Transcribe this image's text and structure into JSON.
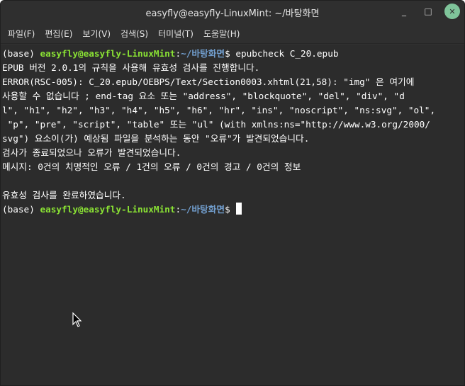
{
  "window": {
    "title": "easyfly@easyfly-LinuxMint: ~/바탕화면",
    "controls": {
      "minimize": "_",
      "maximize": "□",
      "close": "✕"
    }
  },
  "menu": [
    "파일(F)",
    "편집(E)",
    "보기(V)",
    "검색(S)",
    "터미널(T)",
    "도움말(H)"
  ],
  "terminal": {
    "prompt1": {
      "env": "(base) ",
      "user": "easyfly@easyfly-LinuxMint",
      "sep": ":",
      "path": "~/바탕화면",
      "symbol": "$ ",
      "command": "epubcheck C_20.epub"
    },
    "output": [
      "EPUB 버전 2.0.1의 규칙을 사용해 유효성 검사를 진행합니다.",
      "ERROR(RSC-005): C_20.epub/OEBPS/Text/Section0003.xhtml(21,58): \"img\" 은 여기에",
      "사용할 수 없습니다 ; end-tag 요소 또는 \"address\", \"blockquote\", \"del\", \"div\", \"d",
      "l\", \"h1\", \"h2\", \"h3\", \"h4\", \"h5\", \"h6\", \"hr\", \"ins\", \"noscript\", \"ns:svg\", \"ol\",",
      " \"p\", \"pre\", \"script\", \"table\" 또는 \"ul\" (with xmlns:ns=\"http://www.w3.org/2000/",
      "svg\") 요소이(가) 예상됨 파일을 분석하는 동안 \"오류\"가 발견되었습니다.",
      "검사가 종료되었으나 오류가 발견되었습니다.",
      "메시지: 0건의 치명적인 오류 / 1건의 오류 / 0건의 경고 / 0건의 정보",
      "",
      "유효성 검사를 완료하였습니다."
    ],
    "prompt2": {
      "env": "(base) ",
      "user": "easyfly@easyfly-LinuxMint",
      "sep": ":",
      "path": "~/바탕화면",
      "symbol": "$ "
    }
  },
  "colors": {
    "background": "#2c2c2c",
    "text": "#ffffff",
    "user": "#8ae234",
    "path": "#729fcf",
    "close_button": "#7fc49a"
  }
}
